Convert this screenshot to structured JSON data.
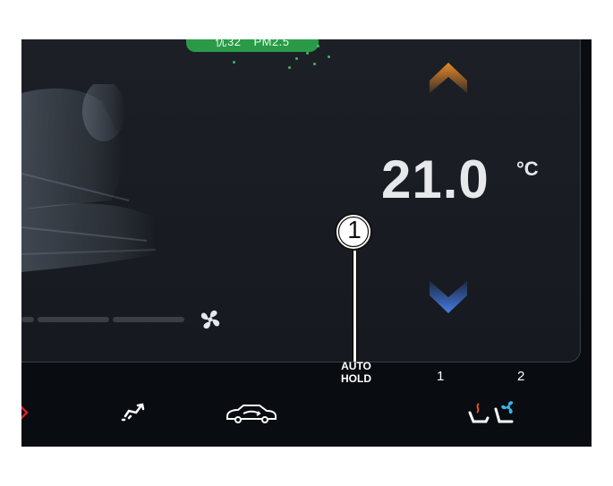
{
  "air_quality": {
    "aqi_label": "优32",
    "pm_label": "PM2.5"
  },
  "temperature": {
    "value": "21.0",
    "unit": "°C"
  },
  "fan": {
    "level_fraction": 0.0
  },
  "callout": {
    "number": "1"
  },
  "bottom_bar": {
    "auto_hold_line1": "AUTO",
    "auto_hold_line2": "HOLD",
    "seat_left_number": "1",
    "seat_right_number": "2"
  },
  "colors": {
    "temp_up_arrow": "#e98a2c",
    "temp_down_arrow": "#3b6fd6",
    "air_quality_badge": "#2a9a49",
    "hazard_icon": "#d6232a",
    "seat_heat_icon": "#e0542a",
    "seat_cool_icon": "#37b6e6"
  },
  "icons": [
    "seat-silhouette-icon",
    "fan-icon",
    "chevron-up-icon",
    "chevron-down-icon",
    "hazard-icon",
    "vent-airflow-icon",
    "car-recirculation-icon",
    "seat-heat-icon",
    "seat-vent-icon"
  ]
}
